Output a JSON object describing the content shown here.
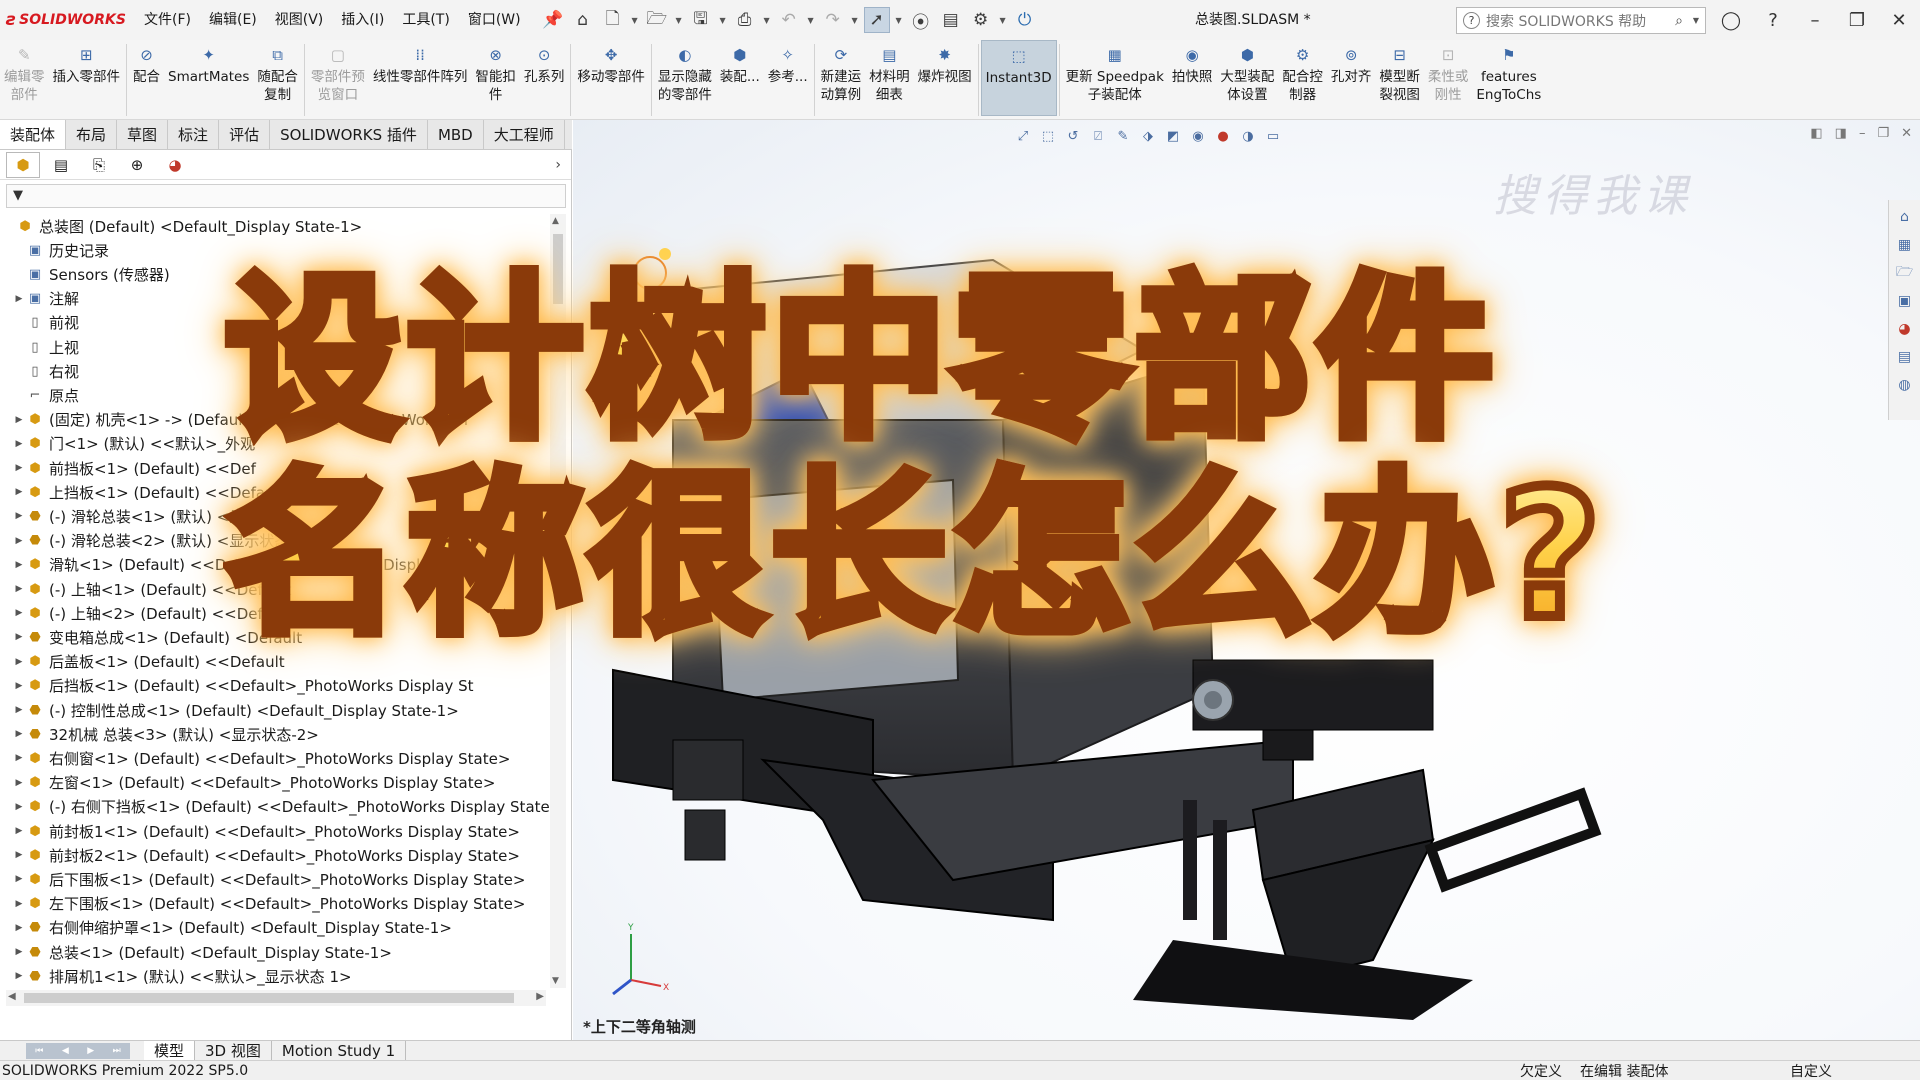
{
  "app": {
    "logo_text": "SOLIDWORKS",
    "document_title": "总装图.SLDASM *"
  },
  "menu": [
    "文件(F)",
    "编辑(E)",
    "视图(V)",
    "插入(I)",
    "工具(T)",
    "窗口(W)"
  ],
  "help_search": {
    "placeholder": "搜索 SOLIDWORKS 帮助"
  },
  "commands": [
    {
      "label": "编辑零\n部件",
      "disabled": true
    },
    {
      "label": "插入零部件",
      "disabled": false
    },
    {
      "label": "配合",
      "disabled": false
    },
    {
      "label": "SmartMates",
      "disabled": false
    },
    {
      "label": "随配合\n复制",
      "disabled": false
    },
    {
      "label": "零部件预\n览窗口",
      "disabled": true
    },
    {
      "label": "线性零部件阵列",
      "disabled": false
    },
    {
      "label": "智能扣\n件",
      "disabled": false
    },
    {
      "label": "孔系列",
      "disabled": false
    },
    {
      "label": "移动零部件",
      "disabled": false
    },
    {
      "label": "显示隐藏\n的零部件",
      "disabled": false
    },
    {
      "label": "装配...",
      "disabled": false
    },
    {
      "label": "参考...",
      "disabled": false
    },
    {
      "label": "新建运\n动算例",
      "disabled": false
    },
    {
      "label": "材料明\n细表",
      "disabled": false
    },
    {
      "label": "爆炸视图",
      "disabled": false
    },
    {
      "label": "Instant3D",
      "disabled": false,
      "pressed": true
    },
    {
      "label": "更新 Speedpak\n子装配体",
      "disabled": false
    },
    {
      "label": "拍快照",
      "disabled": false
    },
    {
      "label": "大型装配\n体设置",
      "disabled": false
    },
    {
      "label": "配合控\n制器",
      "disabled": false
    },
    {
      "label": "孔对齐",
      "disabled": false
    },
    {
      "label": "模型断\n裂视图",
      "disabled": false
    },
    {
      "label": "柔性或\n刚性",
      "disabled": true
    },
    {
      "label": "features\nEngToChs",
      "disabled": false
    }
  ],
  "ribbon_tabs": [
    "装配体",
    "布局",
    "草图",
    "标注",
    "评估",
    "SOLIDWORKS 插件",
    "MBD",
    "大工程师"
  ],
  "active_ribbon_tab": "装配体",
  "filter_text": "▼",
  "tree": [
    {
      "text": "总装图 (Default) <Default_Display State-1>",
      "icon": "asm",
      "indent": 0,
      "exp": ""
    },
    {
      "text": "历史记录",
      "icon": "folder",
      "indent": 1,
      "exp": ""
    },
    {
      "text": "Sensors (传感器)",
      "icon": "folder",
      "indent": 1,
      "exp": ""
    },
    {
      "text": "注解",
      "icon": "folder",
      "indent": 1,
      "exp": "▶"
    },
    {
      "text": "前视",
      "icon": "plane",
      "indent": 1,
      "exp": ""
    },
    {
      "text": "上视",
      "icon": "plane",
      "indent": 1,
      "exp": ""
    },
    {
      "text": "右视",
      "icon": "plane",
      "indent": 1,
      "exp": ""
    },
    {
      "text": "原点",
      "icon": "origin",
      "indent": 1,
      "exp": ""
    },
    {
      "text": "(固定) 机壳<1> -> (Default) <<Default>_PhotoWorks Di",
      "icon": "comp",
      "indent": 1,
      "exp": "▶"
    },
    {
      "text": "门<1> (默认) <<默认>_外观",
      "icon": "comp",
      "indent": 1,
      "exp": "▶"
    },
    {
      "text": "前挡板<1> (Default) <<Def",
      "icon": "comp",
      "indent": 1,
      "exp": "▶"
    },
    {
      "text": "上挡板<1> (Default) <<Default",
      "icon": "comp",
      "indent": 1,
      "exp": "▶"
    },
    {
      "text": "(-) 滑轮总装<1> (默认) <显示状态",
      "icon": "sub",
      "indent": 1,
      "exp": "▶"
    },
    {
      "text": "(-) 滑轮总装<2> (默认) <显示状态",
      "icon": "sub",
      "indent": 1,
      "exp": "▶"
    },
    {
      "text": "滑轨<1> (Default) <<Default>_PhotoWorks Display",
      "icon": "comp",
      "indent": 1,
      "exp": "▶"
    },
    {
      "text": "(-) 上轴<1> (Default) <<Default",
      "icon": "comp",
      "indent": 1,
      "exp": "▶"
    },
    {
      "text": "(-) 上轴<2> (Default) <<Default",
      "icon": "comp",
      "indent": 1,
      "exp": "▶"
    },
    {
      "text": "变电箱总成<1> (Default) <Default",
      "icon": "sub",
      "indent": 1,
      "exp": "▶"
    },
    {
      "text": "后盖板<1> (Default) <<Default",
      "icon": "comp",
      "indent": 1,
      "exp": "▶"
    },
    {
      "text": "后挡板<1> (Default) <<Default>_PhotoWorks Display St",
      "icon": "comp",
      "indent": 1,
      "exp": "▶"
    },
    {
      "text": "(-) 控制性总成<1> (Default) <Default_Display State-1>",
      "icon": "sub",
      "indent": 1,
      "exp": "▶"
    },
    {
      "text": "32机械 总装<3> (默认) <显示状态-2>",
      "icon": "sub",
      "indent": 1,
      "exp": "▶"
    },
    {
      "text": "右侧窗<1> (Default) <<Default>_PhotoWorks Display State>",
      "icon": "comp",
      "indent": 1,
      "exp": "▶"
    },
    {
      "text": "左窗<1> (Default) <<Default>_PhotoWorks Display State>",
      "icon": "comp",
      "indent": 1,
      "exp": "▶"
    },
    {
      "text": "(-) 右侧下挡板<1> (Default) <<Default>_PhotoWorks Display State>",
      "icon": "comp",
      "indent": 1,
      "exp": "▶"
    },
    {
      "text": "前封板1<1> (Default) <<Default>_PhotoWorks Display State>",
      "icon": "comp",
      "indent": 1,
      "exp": "▶"
    },
    {
      "text": "前封板2<1> (Default) <<Default>_PhotoWorks Display State>",
      "icon": "comp",
      "indent": 1,
      "exp": "▶"
    },
    {
      "text": "后下围板<1> (Default) <<Default>_PhotoWorks Display State>",
      "icon": "comp",
      "indent": 1,
      "exp": "▶"
    },
    {
      "text": "左下围板<1> (Default) <<Default>_PhotoWorks Display State>",
      "icon": "comp",
      "indent": 1,
      "exp": "▶"
    },
    {
      "text": "右侧伸缩护罩<1> (Default) <Default_Display State-1>",
      "icon": "sub",
      "indent": 1,
      "exp": "▶"
    },
    {
      "text": "总装<1> (Default) <Default_Display State-1>",
      "icon": "sub",
      "indent": 1,
      "exp": "▶"
    },
    {
      "text": "排屑机1<1> (默认) <<默认>_显示状态 1>",
      "icon": "sub",
      "indent": 1,
      "exp": "▶"
    }
  ],
  "bottom_tabs": [
    "模型",
    "3D 视图",
    "Motion Study 1"
  ],
  "active_bottom_tab": "模型",
  "status": {
    "product": "SOLIDWORKS Premium 2022 SP5.0",
    "definition": "欠定义",
    "editing": "在编辑 装配体",
    "units": "自定义"
  },
  "graphics": {
    "view_label": "*上下二等角轴测",
    "watermark": "搜得我课"
  },
  "headline": {
    "line1": "设计树中零部件",
    "line2": "名称很长怎么办?"
  },
  "colors": {
    "brand": "#d71920",
    "headline_fill_top": "#fff2a8",
    "headline_fill_bottom": "#f4a11d",
    "headline_stroke": "#8a3a0a"
  }
}
